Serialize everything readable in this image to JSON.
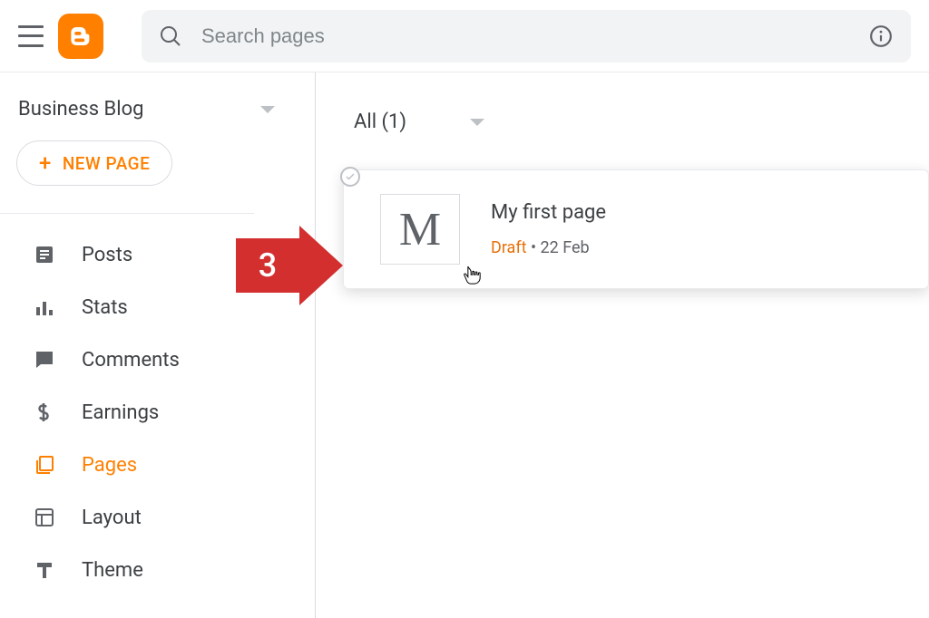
{
  "header": {
    "search_placeholder": "Search pages"
  },
  "sidebar": {
    "blog_title": "Business Blog",
    "new_page_label": "NEW PAGE",
    "nav": [
      {
        "key": "posts",
        "label": "Posts"
      },
      {
        "key": "stats",
        "label": "Stats"
      },
      {
        "key": "comments",
        "label": "Comments"
      },
      {
        "key": "earnings",
        "label": "Earnings"
      },
      {
        "key": "pages",
        "label": "Pages"
      },
      {
        "key": "layout",
        "label": "Layout"
      },
      {
        "key": "theme",
        "label": "Theme"
      }
    ],
    "active_key": "pages"
  },
  "main": {
    "filter_label": "All (1)",
    "page_card": {
      "thumb_letter": "M",
      "title": "My first page",
      "status": "Draft",
      "date": "22 Feb",
      "meta_separator": " • "
    }
  },
  "annotation": {
    "step_number": "3"
  }
}
